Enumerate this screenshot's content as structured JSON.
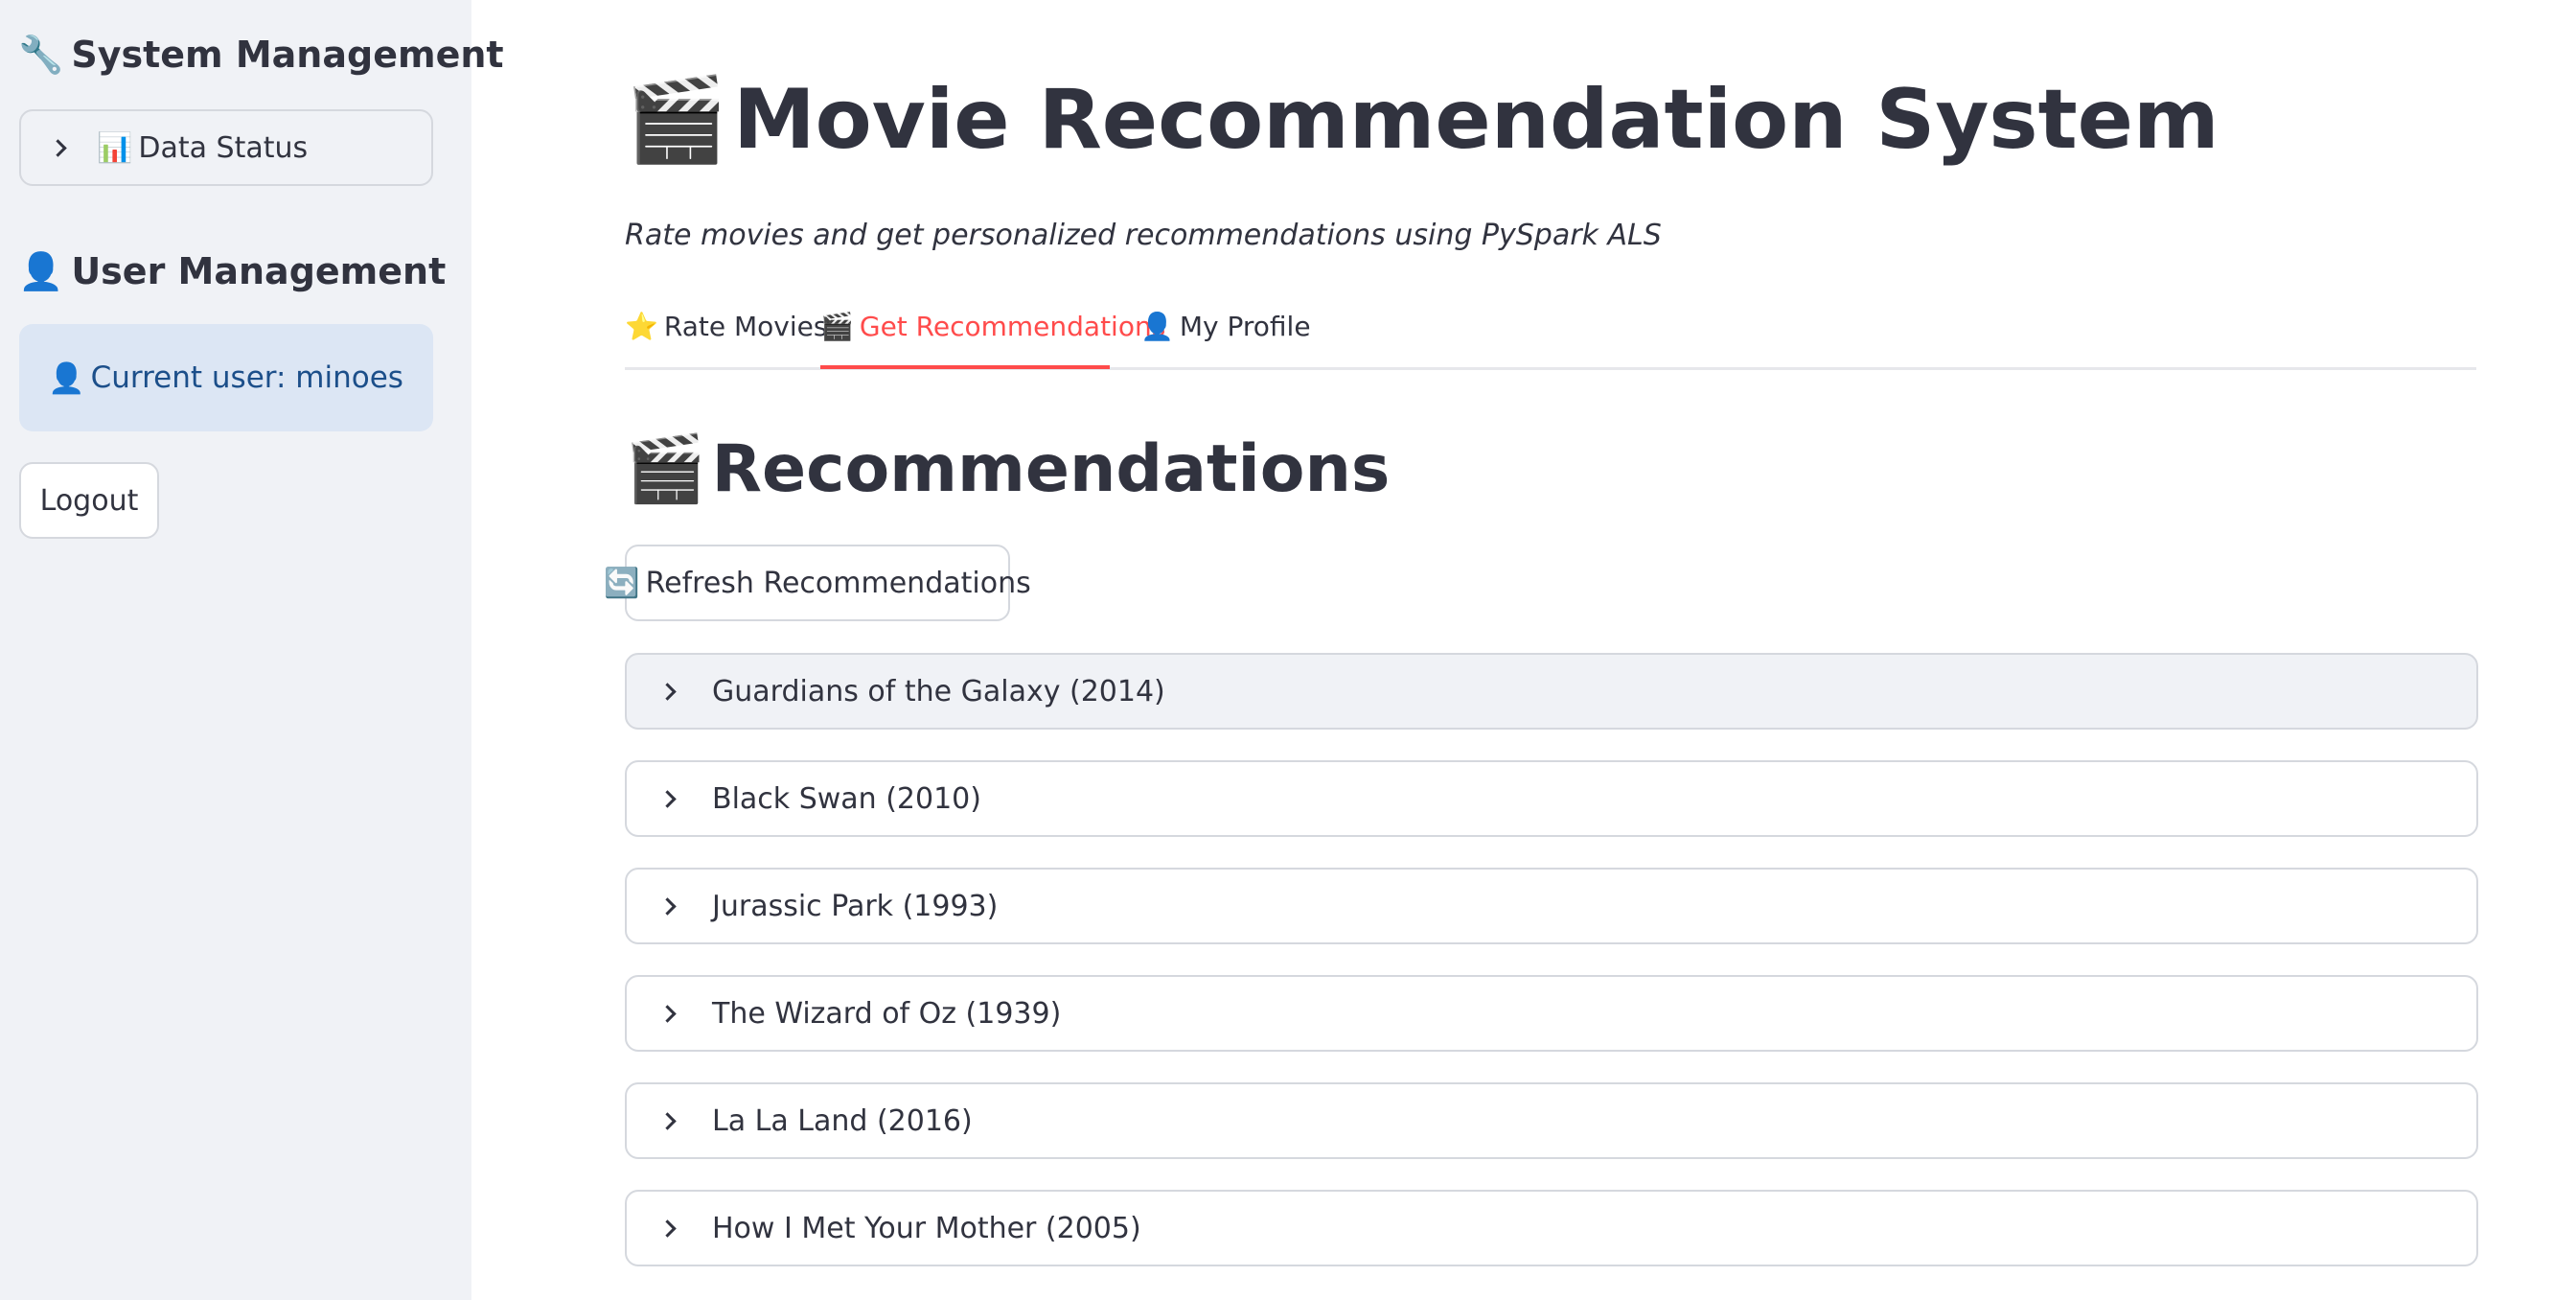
{
  "sidebar": {
    "system_heading": "System Management",
    "system_icon": "wrench-icon",
    "data_status_label": "Data Status",
    "data_status_icon": "bar-chart-icon",
    "user_heading": "User Management",
    "user_icon": "user-icon",
    "current_user": "Current user: minoes",
    "logout_label": "Logout"
  },
  "main": {
    "title": "Movie Recommendation System",
    "title_icon": "clapperboard-icon",
    "subtitle": "Rate movies and get personalized recommendations using PySpark ALS",
    "tabs": [
      {
        "label": "Rate Movies",
        "icon": "star-icon",
        "active": false
      },
      {
        "label": "Get Recommendations",
        "icon": "clapperboard-icon",
        "active": true
      },
      {
        "label": "My Profile",
        "icon": "user-icon",
        "active": false
      }
    ],
    "section_title": "Recommendations",
    "refresh_label": "Refresh Recommendations",
    "refresh_icon": "refresh-icon",
    "movies": [
      "Guardians of the Galaxy (2014)",
      "Black Swan (2010)",
      "Jurassic Park (1993)",
      "The Wizard of Oz (1939)",
      "La La Land (2016)",
      "How I Met Your Mother (2005)"
    ]
  },
  "colors": {
    "accent": "#ff4b4b",
    "sidebar_bg": "#f0f2f6",
    "info_bg": "#dce6f4",
    "info_text": "#1c4f8a"
  }
}
